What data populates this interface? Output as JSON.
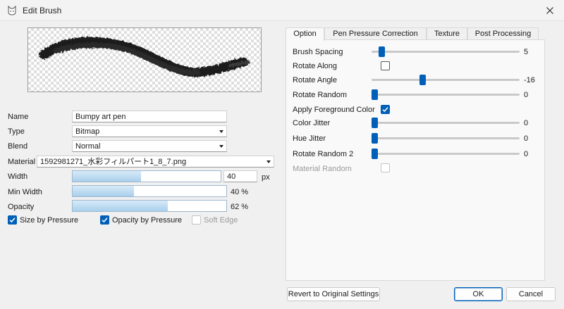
{
  "window": {
    "title": "Edit Brush"
  },
  "fields": {
    "name": {
      "label": "Name",
      "value": "Bumpy art pen"
    },
    "type": {
      "label": "Type",
      "value": "Bitmap"
    },
    "blend": {
      "label": "Blend",
      "value": "Normal"
    },
    "material": {
      "label": "Material",
      "value": "1592981271_水彩フィルパート1_8_7.png"
    }
  },
  "bars": {
    "width": {
      "label": "Width",
      "value": "40",
      "unit": "px",
      "level": 0.46
    },
    "min_width": {
      "label": "Min Width",
      "value": "40 %",
      "level": 0.4
    },
    "opacity": {
      "label": "Opacity",
      "value": "62 %",
      "level": 0.62
    }
  },
  "checks": {
    "size_by_pressure": {
      "label": "Size by Pressure",
      "checked": true
    },
    "opacity_by_pressure": {
      "label": "Opacity by Pressure",
      "checked": true
    },
    "soft_edge": {
      "label": "Soft Edge",
      "checked": false,
      "disabled": true
    }
  },
  "tabs": [
    "Option",
    "Pen Pressure Correction",
    "Texture",
    "Post Processing"
  ],
  "options": {
    "brush_spacing": {
      "label": "Brush Spacing",
      "value": "5",
      "level": 0.05
    },
    "rotate_along": {
      "label": "Rotate Along",
      "checked": false
    },
    "rotate_angle": {
      "label": "Rotate Angle",
      "value": "-16",
      "level": 0.34
    },
    "rotate_random": {
      "label": "Rotate Random",
      "value": "0",
      "level": 0
    },
    "apply_foreground_color": {
      "label": "Apply Foreground Color",
      "checked": true
    },
    "color_jitter": {
      "label": "Color Jitter",
      "value": "0",
      "level": 0
    },
    "hue_jitter": {
      "label": "Hue Jitter",
      "value": "0",
      "level": 0
    },
    "rotate_random_2": {
      "label": "Rotate Random 2",
      "value": "0",
      "level": 0
    },
    "material_random": {
      "label": "Material Random",
      "checked": false,
      "disabled": true
    }
  },
  "buttons": {
    "revert": "Revert to Original Settings",
    "ok": "OK",
    "cancel": "Cancel"
  },
  "colors": {
    "accent": "#005fb8",
    "bar_fill": "#a9cfec"
  }
}
